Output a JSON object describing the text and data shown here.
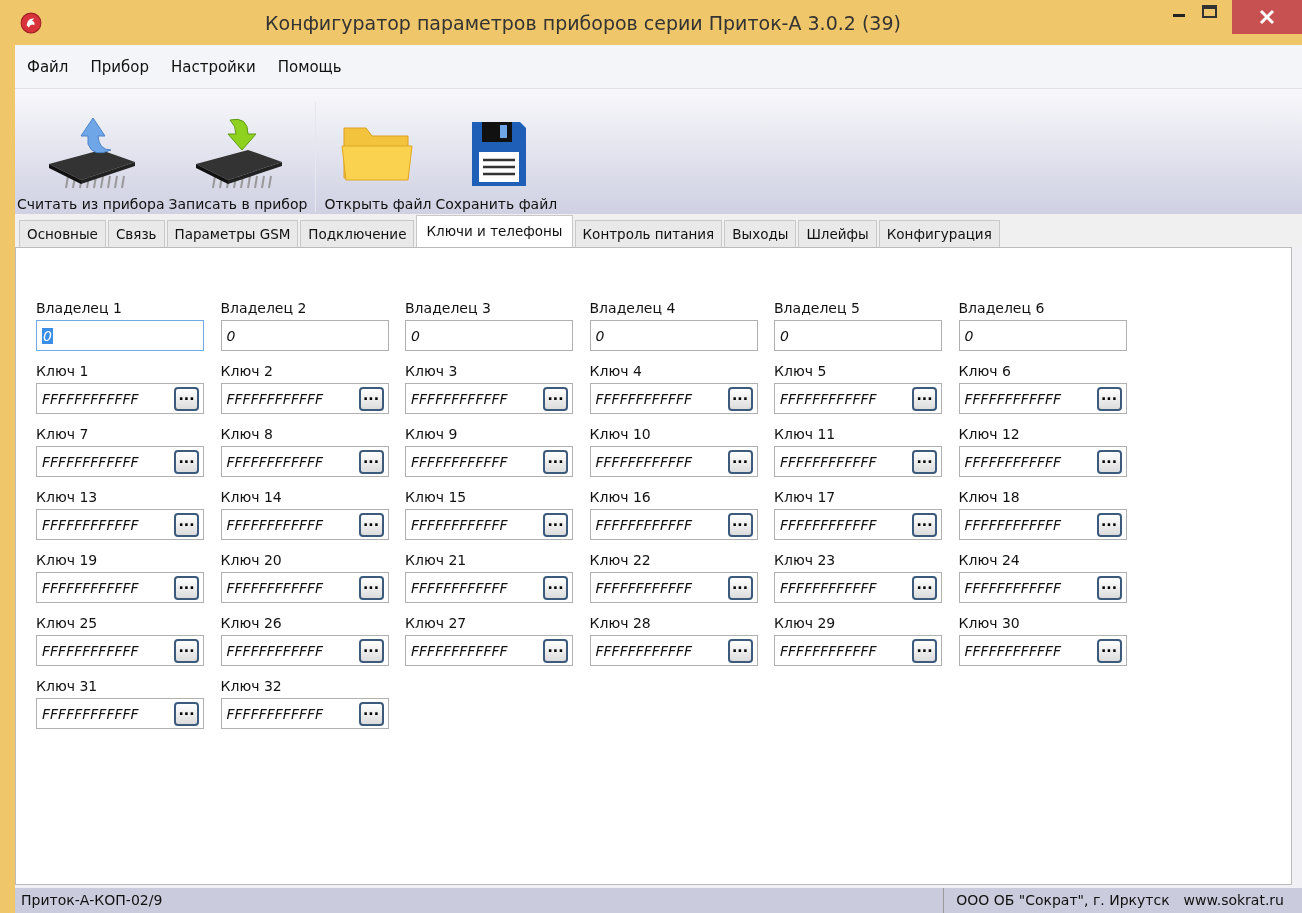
{
  "window": {
    "title": "Конфигуратор параметров приборов серии Приток-А   3.0.2 (39)"
  },
  "menu": [
    "Файл",
    "Прибор",
    "Настройки",
    "Помощь"
  ],
  "toolbar": [
    {
      "kind": "read",
      "label": "Считать из прибора"
    },
    {
      "kind": "write",
      "label": "Записать в прибор"
    },
    {
      "kind": "open",
      "label": "Открыть файл"
    },
    {
      "kind": "save",
      "label": "Сохранить файл"
    }
  ],
  "tabs": [
    {
      "label": "Основные",
      "selected": false
    },
    {
      "label": "Связь",
      "selected": false
    },
    {
      "label": "Параметры GSM",
      "selected": false
    },
    {
      "label": "Подключение",
      "selected": false
    },
    {
      "label": "Ключи и телефоны",
      "selected": true
    },
    {
      "label": "Контроль питания",
      "selected": false
    },
    {
      "label": "Выходы",
      "selected": false
    },
    {
      "label": "Шлейфы",
      "selected": false
    },
    {
      "label": "Конфигурация",
      "selected": false
    }
  ],
  "owners": [
    {
      "label": "Владелец 1",
      "value": "0",
      "focused": true
    },
    {
      "label": "Владелец 2",
      "value": "0",
      "focused": false
    },
    {
      "label": "Владелец 3",
      "value": "0",
      "focused": false
    },
    {
      "label": "Владелец 4",
      "value": "0",
      "focused": false
    },
    {
      "label": "Владелец 5",
      "value": "0",
      "focused": false
    },
    {
      "label": "Владелец 6",
      "value": "0",
      "focused": false
    }
  ],
  "keys": [
    {
      "label": "Ключ 1",
      "value": "FFFFFFFFFFFF"
    },
    {
      "label": "Ключ 2",
      "value": "FFFFFFFFFFFF"
    },
    {
      "label": "Ключ 3",
      "value": "FFFFFFFFFFFF"
    },
    {
      "label": "Ключ 4",
      "value": "FFFFFFFFFFFF"
    },
    {
      "label": "Ключ 5",
      "value": "FFFFFFFFFFFF"
    },
    {
      "label": "Ключ 6",
      "value": "FFFFFFFFFFFF"
    },
    {
      "label": "Ключ 7",
      "value": "FFFFFFFFFFFF"
    },
    {
      "label": "Ключ 8",
      "value": "FFFFFFFFFFFF"
    },
    {
      "label": "Ключ 9",
      "value": "FFFFFFFFFFFF"
    },
    {
      "label": "Ключ 10",
      "value": "FFFFFFFFFFFF"
    },
    {
      "label": "Ключ 11",
      "value": "FFFFFFFFFFFF"
    },
    {
      "label": "Ключ 12",
      "value": "FFFFFFFFFFFF"
    },
    {
      "label": "Ключ 13",
      "value": "FFFFFFFFFFFF"
    },
    {
      "label": "Ключ 14",
      "value": "FFFFFFFFFFFF"
    },
    {
      "label": "Ключ 15",
      "value": "FFFFFFFFFFFF"
    },
    {
      "label": "Ключ 16",
      "value": "FFFFFFFFFFFF"
    },
    {
      "label": "Ключ 17",
      "value": "FFFFFFFFFFFF"
    },
    {
      "label": "Ключ 18",
      "value": "FFFFFFFFFFFF"
    },
    {
      "label": "Ключ 19",
      "value": "FFFFFFFFFFFF"
    },
    {
      "label": "Ключ 20",
      "value": "FFFFFFFFFFFF"
    },
    {
      "label": "Ключ 21",
      "value": "FFFFFFFFFFFF"
    },
    {
      "label": "Ключ 22",
      "value": "FFFFFFFFFFFF"
    },
    {
      "label": "Ключ 23",
      "value": "FFFFFFFFFFFF"
    },
    {
      "label": "Ключ 24",
      "value": "FFFFFFFFFFFF"
    },
    {
      "label": "Ключ 25",
      "value": "FFFFFFFFFFFF"
    },
    {
      "label": "Ключ 26",
      "value": "FFFFFFFFFFFF"
    },
    {
      "label": "Ключ 27",
      "value": "FFFFFFFFFFFF"
    },
    {
      "label": "Ключ 28",
      "value": "FFFFFFFFFFFF"
    },
    {
      "label": "Ключ 29",
      "value": "FFFFFFFFFFFF"
    },
    {
      "label": "Ключ 30",
      "value": "FFFFFFFFFFFF"
    },
    {
      "label": "Ключ 31",
      "value": "FFFFFFFFFFFF"
    },
    {
      "label": "Ключ 32",
      "value": "FFFFFFFFFFFF"
    }
  ],
  "key_button_label": "···",
  "status_bar": {
    "device": "Приток-А-КОП-02/9",
    "company": "ООО ОБ \"Сократ\", г. Иркутск",
    "website": "www.sokrat.ru"
  }
}
